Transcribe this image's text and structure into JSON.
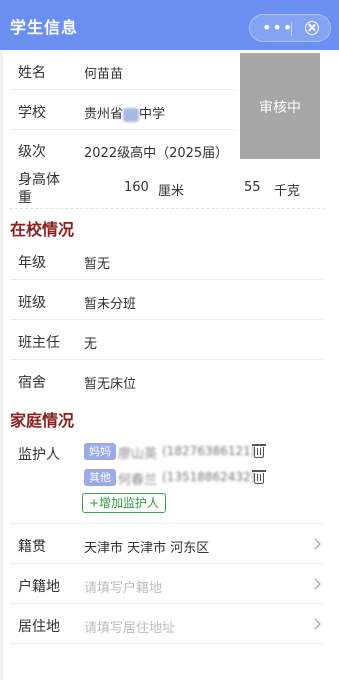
{
  "header": {
    "title": "学生信息",
    "more_icon": "•••"
  },
  "student": {
    "name_label": "姓名",
    "name": "何苗苗",
    "school_label": "学校",
    "school_prefix": "贵州省",
    "school_suffix": "中学",
    "grade_level_label": "级次",
    "grade_level": "2022级高中（2025届）",
    "body_label": "身高体重",
    "height": "160",
    "height_unit": "厘米",
    "weight": "55",
    "weight_unit": "千克",
    "photo_status": "审核中"
  },
  "school_section": {
    "title": "在校情况",
    "rows": [
      {
        "label": "年级",
        "value": "暂无"
      },
      {
        "label": "班级",
        "value": "暂未分班"
      },
      {
        "label": "班主任",
        "value": "无"
      },
      {
        "label": "宿舍",
        "value": "暂无床位"
      }
    ]
  },
  "family_section": {
    "title": "家庭情况",
    "guardian_label": "监护人",
    "guardians": [
      {
        "relation": "妈妈",
        "name": "廖山英",
        "phone": "(18276386121)"
      },
      {
        "relation": "其他",
        "name": "何春兰",
        "phone": "(13518862432)"
      }
    ],
    "add_guardian": "+增加监护人",
    "native_place_label": "籍贯",
    "native_place": "天津市 天津市 河东区",
    "household_label": "户籍地",
    "household_placeholder": "请填写户籍地",
    "residence_label": "居住地",
    "residence_placeholder": "请填写居住地址"
  }
}
